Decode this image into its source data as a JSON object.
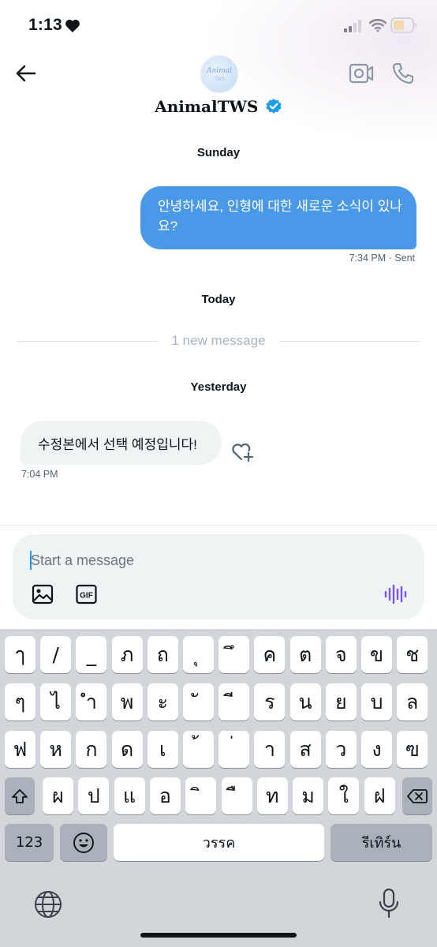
{
  "status_bar": {
    "time": "1:13"
  },
  "header": {
    "display_name": "AnimalTWS",
    "avatar_text": "Animal",
    "avatar_subtext": "TWS"
  },
  "conversation": {
    "sections": [
      {
        "day": "Sunday"
      },
      {
        "day": "Today"
      },
      {
        "day": "Yesterday"
      }
    ],
    "outgoing": {
      "text": "안녕하세요, 인형에 대한 새로운 소식이 있나요?",
      "time": "7:34 PM",
      "status": "· Sent"
    },
    "new_divider": "1 new message",
    "incoming": {
      "text": "수정본에서 선택 예정입니다!",
      "time": "7:04 PM"
    }
  },
  "composer": {
    "placeholder": "Start a message",
    "gif_label": "GIF"
  },
  "keyboard": {
    "row1": [
      "ๅ",
      "/",
      "_",
      "ภ",
      "ถ",
      "ุ",
      "ึ",
      "ค",
      "ต",
      "จ",
      "ข",
      "ช"
    ],
    "row2": [
      "ๆ",
      "ไ",
      "ำ",
      "พ",
      "ะ",
      "ั",
      "ี",
      "ร",
      "น",
      "ย",
      "บ",
      "ล"
    ],
    "row3": [
      "ฟ",
      "ห",
      "ก",
      "ด",
      "เ",
      "้",
      "่",
      "า",
      "ส",
      "ว",
      "ง",
      "ฃ"
    ],
    "row4": [
      "ผ",
      "ป",
      "แ",
      "อ",
      "ิ",
      "ื",
      "ท",
      "ม",
      "ใ",
      "ฝ"
    ],
    "numbers_key": "123",
    "space_key": "วรรค",
    "return_key": "รีเทิร์น"
  },
  "colors": {
    "accent": "#1d9bf0",
    "outgoing_bubble": "#4a99e9",
    "incoming_bubble": "#eff3f4",
    "voice_icon": "#7856ff"
  }
}
